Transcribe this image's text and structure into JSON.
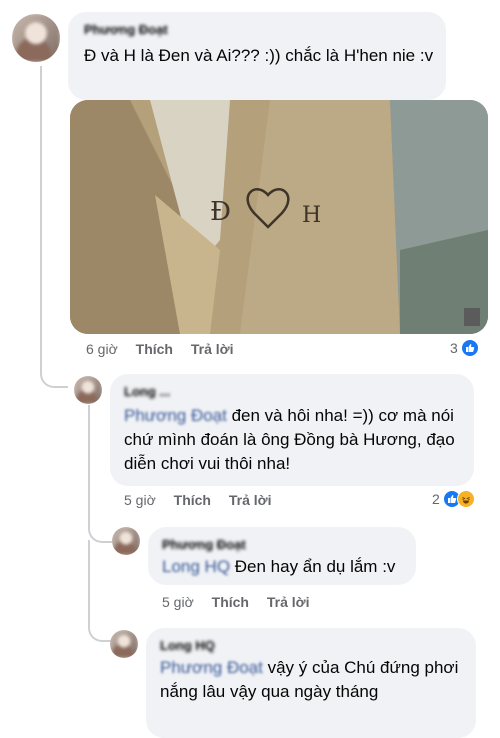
{
  "comments": [
    {
      "name": "Phương Đoạt",
      "text": "Đ và H là Đen và Ai??? :)) chắc là H'hen nie :v",
      "time": "6 giờ",
      "like": "Thích",
      "reply": "Trả lời",
      "reactions": "3"
    },
    {
      "name": "Long ...",
      "mention": "Phương Đoạt",
      "text": " đen và hôi nha! =)) cơ mà nói chứ mình đoán là ông Đồng bà Hương, đạo diễn chơi vui thôi nha!",
      "time": "5 giờ",
      "like": "Thích",
      "reply": "Trả lời",
      "reactions": "2"
    },
    {
      "name": "Phương Đoạt",
      "mention": "Long HQ",
      "text": " Đen hay ẩn dụ lắm :v",
      "time": "5 giờ",
      "like": "Thích",
      "reply": "Trả lời"
    },
    {
      "name": "Long HQ",
      "mention": "Phương Đoạt",
      "text": " vậy ý của Chú đứng phơi nắng lâu vậy qua ngày tháng"
    }
  ],
  "icons": [
    "like-icon",
    "haha-icon"
  ],
  "colors": {
    "like": "#1877f2",
    "haha": "#f7b125",
    "mention": "#385898",
    "bubble": "#f0f2f5"
  }
}
